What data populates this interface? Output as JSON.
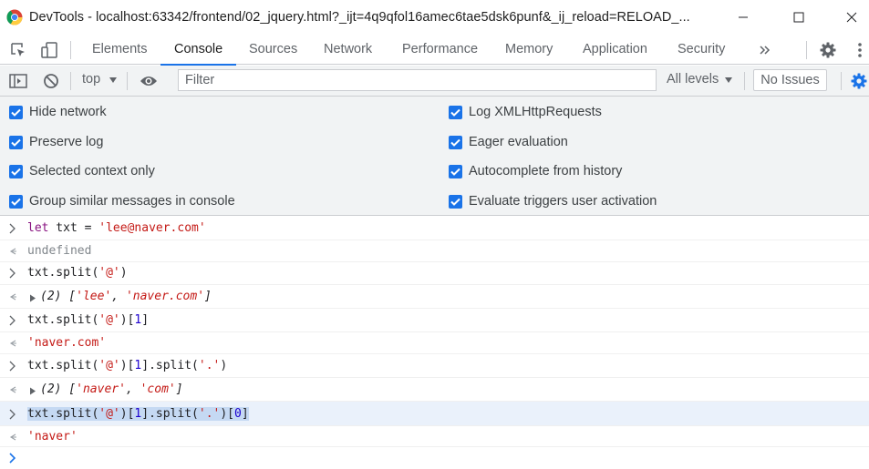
{
  "window": {
    "title": "DevTools - localhost:63342/frontend/02_jquery.html?_ijt=4q9qfol16amec6tae5dsk6punf&_ij_reload=RELOAD_..."
  },
  "tabs": [
    {
      "label": "Elements"
    },
    {
      "label": "Console"
    },
    {
      "label": "Sources"
    },
    {
      "label": "Network"
    },
    {
      "label": "Performance"
    },
    {
      "label": "Memory"
    },
    {
      "label": "Application"
    },
    {
      "label": "Security"
    }
  ],
  "toolbar": {
    "context": "top",
    "filter_placeholder": "Filter",
    "levels": "All levels",
    "issues": "No Issues"
  },
  "settings": {
    "left": [
      {
        "label": "Hide network",
        "checked": true
      },
      {
        "label": "Preserve log",
        "checked": true
      },
      {
        "label": "Selected context only",
        "checked": true
      },
      {
        "label": "Group similar messages in console",
        "checked": true
      }
    ],
    "right": [
      {
        "label": "Log XMLHttpRequests",
        "checked": true
      },
      {
        "label": "Eager evaluation",
        "checked": true
      },
      {
        "label": "Autocomplete from history",
        "checked": true
      },
      {
        "label": "Evaluate triggers user activation",
        "checked": true
      }
    ]
  },
  "console": {
    "c1": {
      "kw": "let",
      "rest": " txt = ",
      "str": "'lee@naver.com'"
    },
    "o1": "undefined",
    "c2": {
      "a": "txt.split(",
      "s": "'@'",
      "b": ")"
    },
    "o2": {
      "count": "(2) [",
      "s1": "'lee'",
      "sep": ", ",
      "s2": "'naver.com'",
      "end": "]"
    },
    "c3": {
      "a": "txt.split(",
      "s": "'@'",
      "b": ")[",
      "n": "1",
      "c": "]"
    },
    "o3": "'naver.com'",
    "c4": {
      "a": "txt.split(",
      "s": "'@'",
      "b": ")[",
      "n": "1",
      "c": "].split(",
      "s2": "'.'",
      "d": ")"
    },
    "o4": {
      "count": "(2) [",
      "s1": "'naver'",
      "sep": ", ",
      "s2": "'com'",
      "end": "]"
    },
    "c5": {
      "a": "txt.split(",
      "s": "'@'",
      "b": ")[",
      "n": "1",
      "c": "].split(",
      "s2": "'.'",
      "d": ")[",
      "n2": "0",
      "e": "]"
    },
    "o5": "'naver'"
  },
  "colors": {
    "accent": "#1a73e8",
    "string": "#c41a16",
    "keyword": "#881280",
    "number": "#1c00cf"
  }
}
